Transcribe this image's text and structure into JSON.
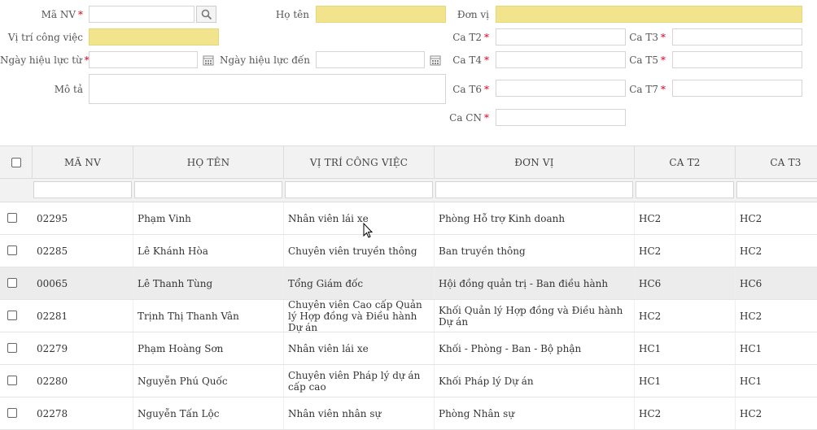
{
  "form": {
    "ma_nv_label": "Mã NV",
    "ho_ten_label": "Họ tên",
    "don_vi_label": "Đơn vị",
    "vi_tri_label": "Vị trí công việc",
    "ngay_hl_tu_label": "Ngày hiệu lực từ",
    "ngay_hl_den_label": "Ngày hiệu lực đến",
    "mo_ta_label": "Mô tả",
    "ca_t2_label": "Ca T2",
    "ca_t3_label": "Ca T3",
    "ca_t4_label": "Ca T4",
    "ca_t5_label": "Ca T5",
    "ca_t6_label": "Ca T6",
    "ca_t7_label": "Ca T7",
    "ca_cn_label": "Ca CN",
    "required_mark": "*",
    "required_color": "#d9001b",
    "highlight_color": "#f2e48c"
  },
  "grid": {
    "columns": [
      "MÃ NV",
      "HỌ TÊN",
      "VỊ TRÍ CÔNG VIỆC",
      "ĐƠN VỊ",
      "CA T2",
      "CA T3"
    ],
    "rows": [
      {
        "ma_nv": "02295",
        "ho_ten": "Phạm Vinh",
        "vi_tri": "Nhân viên lái xe",
        "don_vi": "Phòng Hỗ trợ Kinh doanh",
        "ca_t2": "HC2",
        "ca_t3": "HC2"
      },
      {
        "ma_nv": "02285",
        "ho_ten": "Lê Khánh Hòa",
        "vi_tri": "Chuyên viên truyền thông",
        "don_vi": "Ban truyền thông",
        "ca_t2": "HC2",
        "ca_t3": "HC2"
      },
      {
        "ma_nv": "00065",
        "ho_ten": "Lê Thanh Tùng",
        "vi_tri": "Tổng Giám đốc",
        "don_vi": "Hội đồng quản trị - Ban điều hành",
        "ca_t2": "HC6",
        "ca_t3": "HC6"
      },
      {
        "ma_nv": "02281",
        "ho_ten": "Trịnh Thị Thanh Vân",
        "vi_tri": "Chuyên viên Cao cấp Quản lý Hợp đồng và Điều hành Dự án",
        "don_vi": "Khối Quản lý Hợp đồng và Điều hành Dự án",
        "ca_t2": "HC2",
        "ca_t3": "HC2"
      },
      {
        "ma_nv": "02279",
        "ho_ten": "Phạm Hoàng Sơn",
        "vi_tri": "Nhân viên lái xe",
        "don_vi": "Khối - Phòng - Ban - Bộ phận",
        "ca_t2": "HC1",
        "ca_t3": "HC1"
      },
      {
        "ma_nv": "02280",
        "ho_ten": "Nguyễn Phú Quốc",
        "vi_tri": "Chuyên viên Pháp lý dự án cấp cao",
        "don_vi": "Khối Pháp lý Dự án",
        "ca_t2": "HC1",
        "ca_t3": "HC1"
      },
      {
        "ma_nv": "02278",
        "ho_ten": "Nguyễn Tấn Lộc",
        "vi_tri": "Nhân viên nhân sự",
        "don_vi": "Phòng Nhân sự",
        "ca_t2": "HC2",
        "ca_t3": "HC2"
      }
    ]
  }
}
